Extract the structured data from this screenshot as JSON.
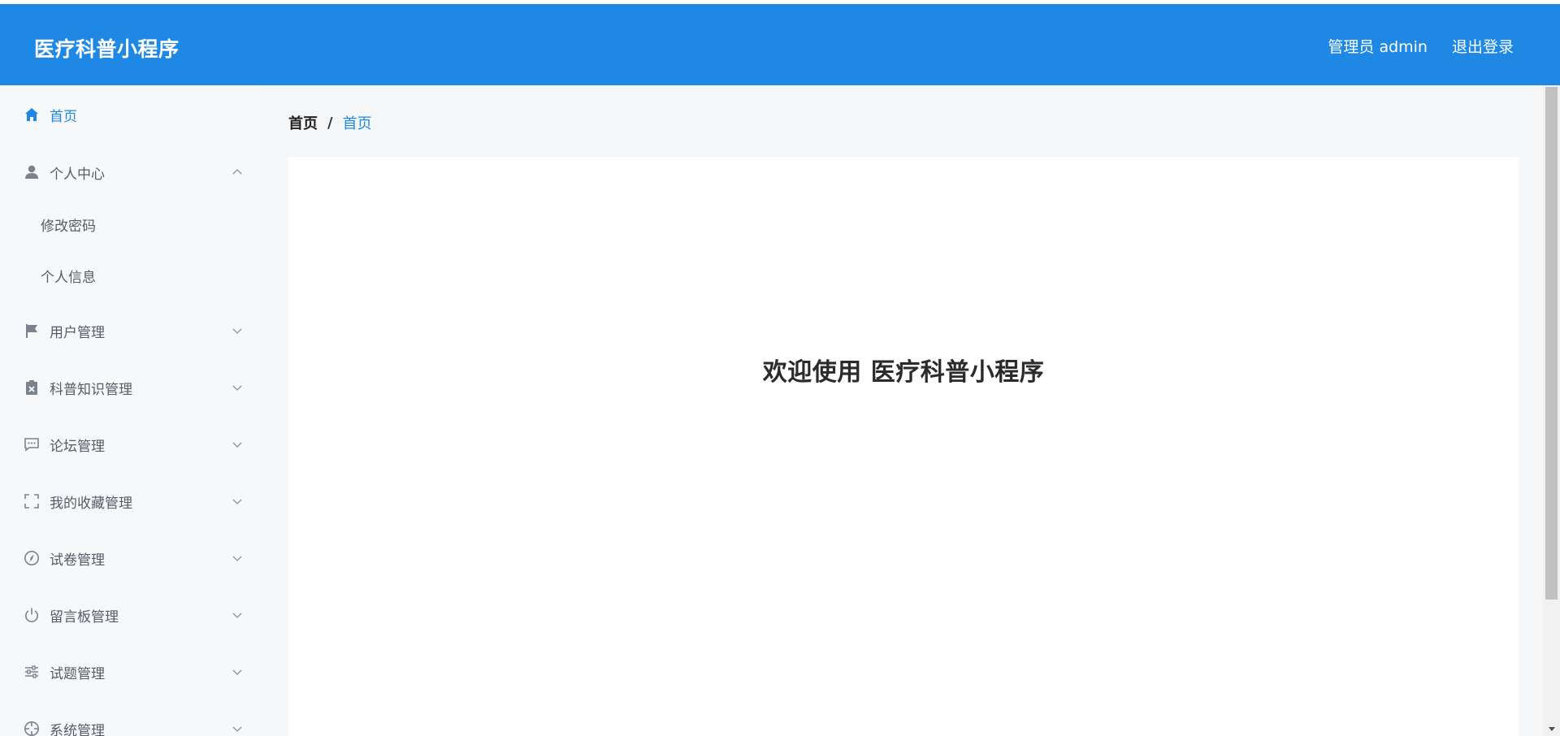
{
  "header": {
    "title": "医疗科普小程序",
    "user_label": "管理员 admin",
    "logout_label": "退出登录"
  },
  "sidebar": {
    "items": [
      {
        "label": "首页",
        "icon": "home-icon",
        "active": true
      },
      {
        "label": "个人中心",
        "icon": "user-icon",
        "expanded": true,
        "children": [
          {
            "label": "修改密码"
          },
          {
            "label": "个人信息"
          }
        ]
      },
      {
        "label": "用户管理",
        "icon": "flag-icon"
      },
      {
        "label": "科普知识管理",
        "icon": "clipboard-x-icon"
      },
      {
        "label": "论坛管理",
        "icon": "chat-bubble-icon"
      },
      {
        "label": "我的收藏管理",
        "icon": "fullscreen-icon"
      },
      {
        "label": "试卷管理",
        "icon": "compass-icon"
      },
      {
        "label": "留言板管理",
        "icon": "power-icon"
      },
      {
        "label": "试题管理",
        "icon": "sliders-icon"
      },
      {
        "label": "系统管理",
        "icon": "crosshair-icon"
      }
    ]
  },
  "breadcrumb": {
    "root": "首页",
    "separator": "/",
    "current": "首页"
  },
  "main": {
    "welcome": "欢迎使用 医疗科普小程序"
  },
  "colors": {
    "primary": "#1f88e5",
    "sidebar_bg": "#f7f8fa",
    "main_bg": "#f5f6f8"
  }
}
